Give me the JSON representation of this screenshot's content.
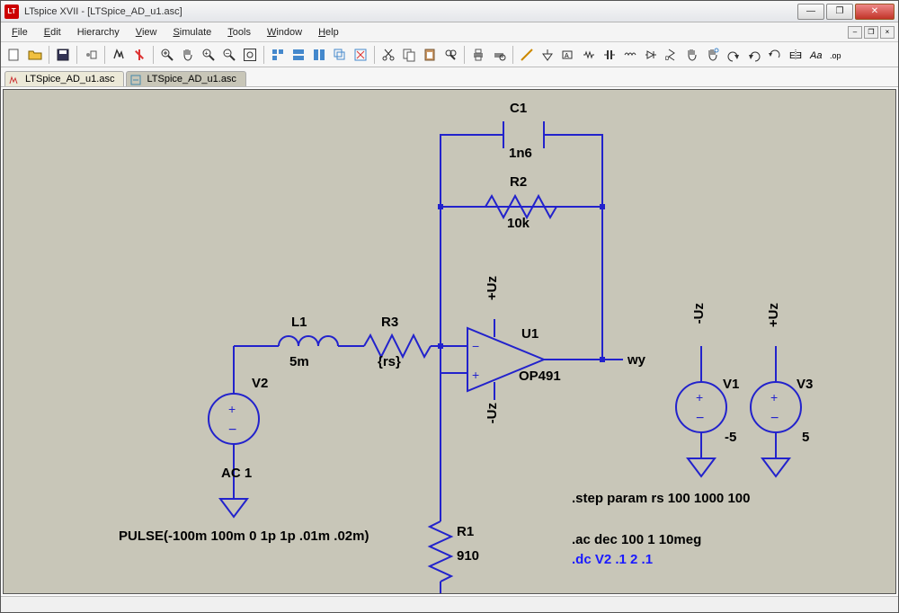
{
  "window": {
    "title": "LTspice XVII - [LTSpice_AD_u1.asc]"
  },
  "menu": {
    "items": [
      "File",
      "Edit",
      "Hierarchy",
      "View",
      "Simulate",
      "Tools",
      "Window",
      "Help"
    ]
  },
  "tabs": {
    "t0": "LTSpice_AD_u1.asc",
    "t1": "LTSpice_AD_u1.asc"
  },
  "components": {
    "C1": {
      "ref": "C1",
      "val": "1n6"
    },
    "R2": {
      "ref": "R2",
      "val": "10k"
    },
    "L1": {
      "ref": "L1",
      "val": "5m"
    },
    "R3": {
      "ref": "R3",
      "val": "{rs}"
    },
    "U1": {
      "ref": "U1",
      "val": "OP491"
    },
    "V2": {
      "ref": "V2",
      "val": "AC 1"
    },
    "R1": {
      "ref": "R1",
      "val": "910"
    },
    "V1": {
      "ref": "V1",
      "val": "-5"
    },
    "V3": {
      "ref": "V3",
      "val": "5"
    }
  },
  "nets": {
    "plusUz": "+Uz",
    "minusUz": "-Uz",
    "wy": "wy"
  },
  "directives": {
    "pulse": "PULSE(-100m 100m 0 1p 1p .01m .02m)",
    "step": ".step param rs 100 1000 100",
    "ac": ".ac dec 100 1 10meg",
    "dc": ".dc V2 .1 2 .1"
  }
}
